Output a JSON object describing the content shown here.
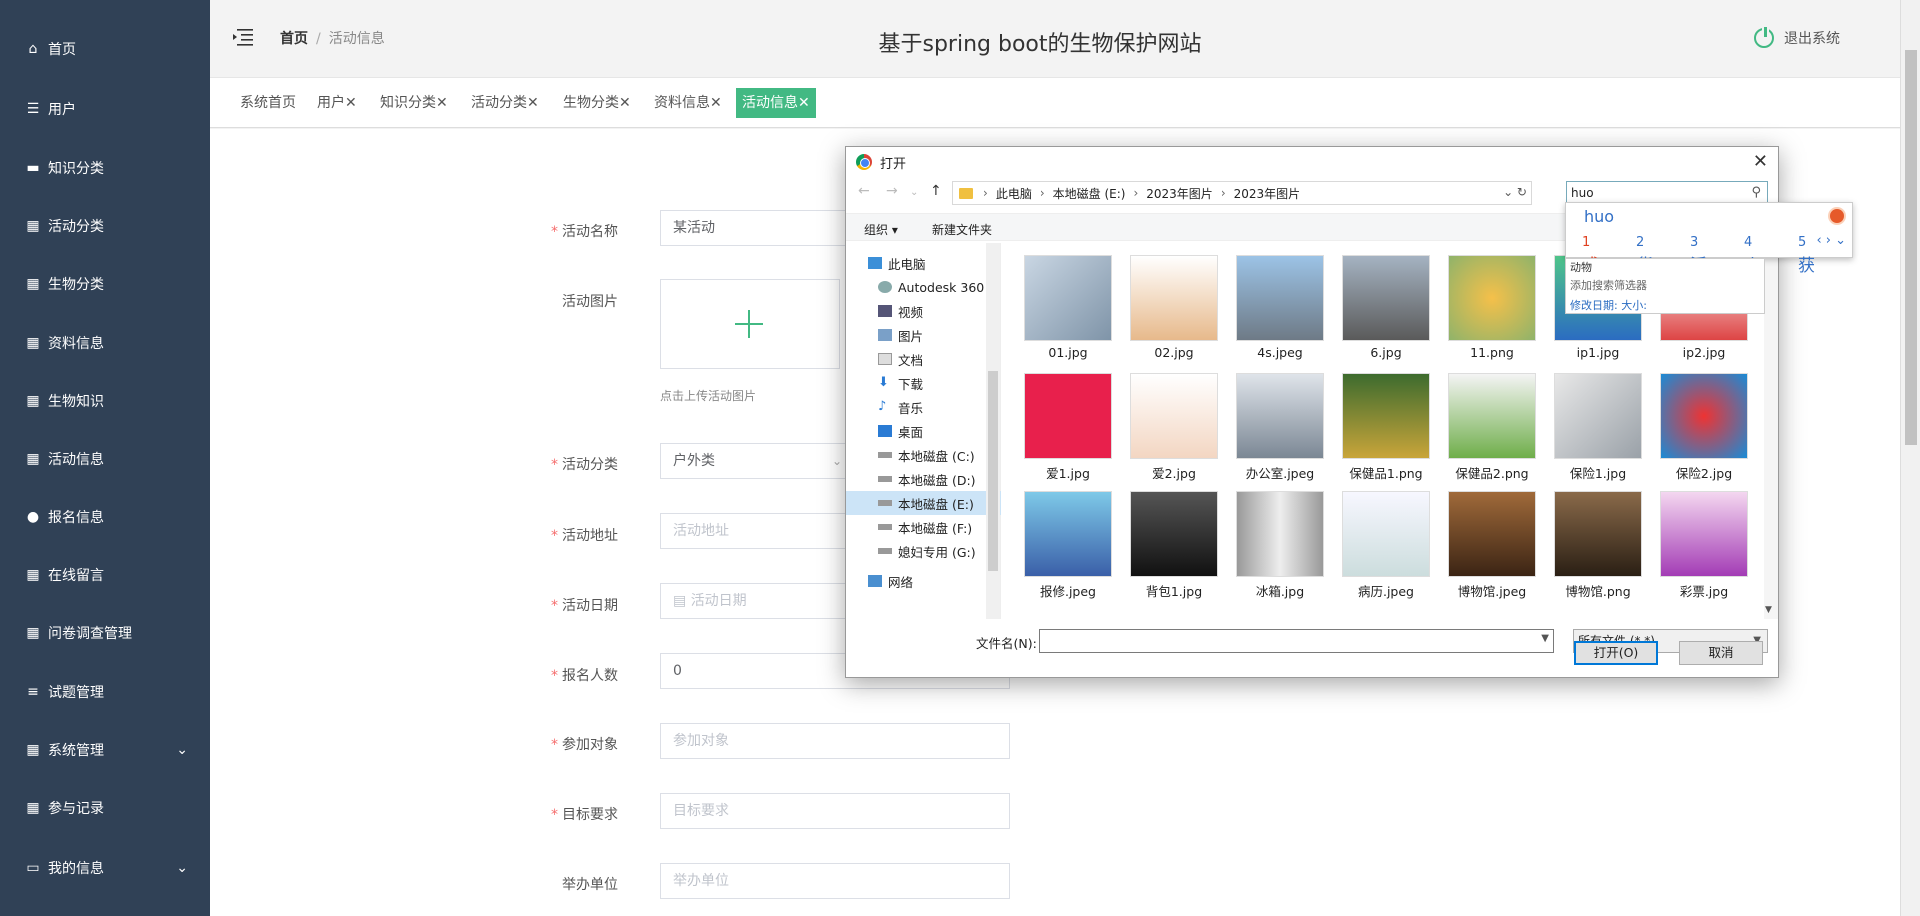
{
  "sidebar": {
    "items": [
      {
        "label": "首页",
        "icon": "home-icon"
      },
      {
        "label": "用户",
        "icon": "sliders-icon"
      },
      {
        "label": "知识分类",
        "icon": "briefcase-icon"
      },
      {
        "label": "活动分类",
        "icon": "grid-icon"
      },
      {
        "label": "生物分类",
        "icon": "grid-icon"
      },
      {
        "label": "资料信息",
        "icon": "grid-icon"
      },
      {
        "label": "生物知识",
        "icon": "grid-icon"
      },
      {
        "label": "活动信息",
        "icon": "grid-icon"
      },
      {
        "label": "报名信息",
        "icon": "user-icon"
      },
      {
        "label": "在线留言",
        "icon": "grid-icon"
      },
      {
        "label": "问卷调查管理",
        "icon": "grid-icon"
      },
      {
        "label": "试题管理",
        "icon": "list-icon"
      },
      {
        "label": "系统管理",
        "icon": "grid-icon"
      },
      {
        "label": "参与记录",
        "icon": "grid-icon"
      },
      {
        "label": "我的信息",
        "icon": "monitor-icon"
      }
    ]
  },
  "header": {
    "breadcrumb_home": "首页",
    "breadcrumb_sep": "/",
    "breadcrumb_current": "活动信息",
    "title": "基于spring boot的生物保护网站",
    "logout": "退出系统"
  },
  "tabs": [
    {
      "label": "系统首页"
    },
    {
      "label": "用户✕"
    },
    {
      "label": "知识分类✕"
    },
    {
      "label": "活动分类✕"
    },
    {
      "label": "生物分类✕"
    },
    {
      "label": "资料信息✕"
    },
    {
      "label": "活动信息✕"
    }
  ],
  "form": {
    "name_label": "活动名称",
    "name_value": "某活动",
    "image_label": "活动图片",
    "image_tip": "点击上传活动图片",
    "category_label": "活动分类",
    "category_value": "户外类",
    "address_label": "活动地址",
    "address_placeholder": "活动地址",
    "date_label": "活动日期",
    "date_placeholder": "活动日期",
    "count_label": "报名人数",
    "count_value": "0",
    "target_label": "参加对象",
    "target_placeholder": "参加对象",
    "goal_label": "目标要求",
    "goal_placeholder": "目标要求",
    "org_label": "举办单位",
    "org_placeholder": "举办单位",
    "required_mark": "*"
  },
  "dialog": {
    "title": "打开",
    "path": [
      "此电脑",
      "本地磁盘 (E:)",
      "2023年图片",
      "2023年图片"
    ],
    "search_value": "huo",
    "organize": "组织 ▾",
    "new_folder": "新建文件夹",
    "tree": [
      "此电脑",
      "Autodesk 360",
      "视频",
      "图片",
      "文档",
      "下载",
      "音乐",
      "桌面",
      "本地磁盘 (C:)",
      "本地磁盘 (D:)",
      "本地磁盘 (E:)",
      "本地磁盘 (F:)",
      "媳妇专用 (G:)",
      "网络"
    ],
    "files": [
      "01.jpg",
      "02.jpg",
      "4s.jpeg",
      "6.jpg",
      "11.png",
      "ip1.jpg",
      "ip2.jpg",
      "爱1.jpg",
      "爱2.jpg",
      "办公室.jpeg",
      "保健品1.png",
      "保健品2.png",
      "保险1.jpg",
      "保险2.jpg",
      "报修.jpeg",
      "背包1.jpg",
      "冰箱.jpg",
      "病历.jpeg",
      "博物馆.jpeg",
      "博物馆.png",
      "彩票.jpg"
    ],
    "filename_label": "文件名(N):",
    "filetype": "所有文件 (*.*)",
    "open_btn": "打开(O)",
    "cancel_btn": "取消"
  },
  "ime": {
    "composition": "huo",
    "candidates": [
      {
        "n": "1",
        "c": "或"
      },
      {
        "n": "2",
        "c": "货"
      },
      {
        "n": "3",
        "c": "活"
      },
      {
        "n": "4",
        "c": "火"
      },
      {
        "n": "5",
        "c": "获"
      }
    ],
    "suggest_1": "动物",
    "suggest_2": "添加搜索筛选器",
    "suggest_3": "修改日期:    大小:"
  },
  "colors": {
    "sidebar": "#304156",
    "accent": "#42b983",
    "required": "#f56c6c"
  }
}
